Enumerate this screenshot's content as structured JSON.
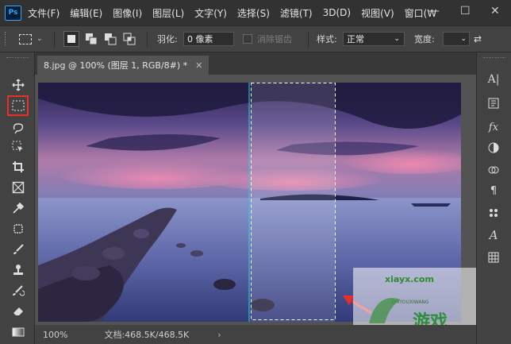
{
  "app": {
    "logo": "Ps"
  },
  "menu": [
    "文件(F)",
    "编辑(E)",
    "图像(I)",
    "图层(L)",
    "文字(Y)",
    "选择(S)",
    "滤镜(T)",
    "3D(D)",
    "视图(V)",
    "窗口(W"
  ],
  "window_controls": {
    "minimize": "—",
    "maximize": "☐",
    "close": "✕"
  },
  "options": {
    "feather_label": "羽化:",
    "feather_value": "0 像素",
    "antialias_label": "消除锯齿",
    "style_label": "样式:",
    "style_value": "正常",
    "width_label": "宽度:"
  },
  "document": {
    "tab_title": "8.jpg @ 100% (图层 1, RGB/8#) *"
  },
  "status": {
    "zoom": "100%",
    "doc_info": "文档:468.5K/468.5K"
  },
  "watermark": {
    "line1": "xiayx.com",
    "line2": "游戏",
    "brand": "ZHIYOUXIWANG"
  },
  "icons": {
    "left_tools": [
      "move-icon",
      "rect-marquee-icon",
      "lasso-icon",
      "object-select-icon",
      "crop-icon",
      "frame-icon",
      "eyedropper-icon",
      "healing-icon",
      "brush-icon",
      "stamp-icon",
      "history-brush-icon",
      "eraser-icon",
      "gradient-icon"
    ],
    "right_panel": [
      "character-icon",
      "paragraph-style-icon",
      "fx-icon",
      "adjustments-icon",
      "channels-icon",
      "paragraph-icon",
      "properties-icon",
      "glyphs-icon",
      "table-icon"
    ]
  },
  "colors": {
    "accent_red": "#e8302a",
    "selection_guide": "#29d3e8"
  }
}
